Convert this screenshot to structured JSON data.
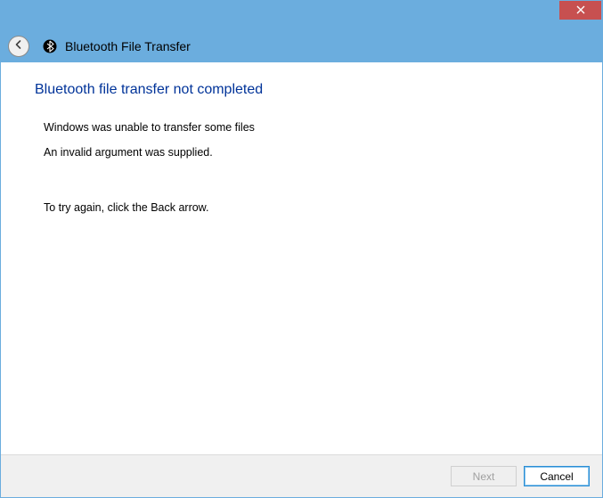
{
  "window": {
    "title": "Bluetooth File Transfer"
  },
  "page": {
    "heading": "Bluetooth file transfer not completed",
    "msg_primary": "Windows was unable to transfer some files",
    "msg_error": "An invalid argument was supplied.",
    "msg_instruction": "To try again, click the Back arrow."
  },
  "buttons": {
    "next": "Next",
    "cancel": "Cancel"
  }
}
